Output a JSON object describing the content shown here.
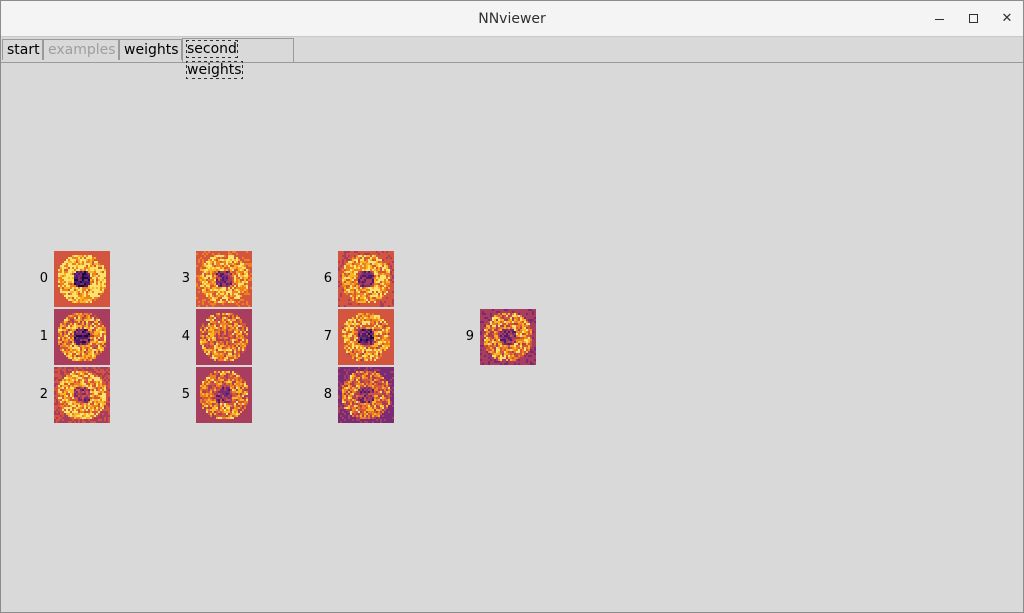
{
  "window": {
    "title": "NNviewer"
  },
  "tabs": [
    {
      "label": "start",
      "state": "normal"
    },
    {
      "label": "examples",
      "state": "disabled"
    },
    {
      "label": "weights",
      "state": "normal"
    },
    {
      "label": "second weights",
      "state": "active"
    }
  ],
  "weights": {
    "colormap": [
      "#1a0b3c",
      "#4c1d6b",
      "#7a2b76",
      "#a83d5e",
      "#d4553f",
      "#f07f20",
      "#f9b51f",
      "#fbe36c"
    ],
    "items": [
      {
        "label": "0",
        "base": 4.3,
        "ring": 6.3,
        "center": 1.0
      },
      {
        "label": "1",
        "base": 3.0,
        "ring": 5.2,
        "center": 1.4
      },
      {
        "label": "2",
        "base": 3.5,
        "ring": 5.6,
        "center": 2.8
      },
      {
        "label": "3",
        "base": 4.4,
        "ring": 5.8,
        "center": 2.3
      },
      {
        "label": "4",
        "base": 3.2,
        "ring": 5.0,
        "center": 4.0
      },
      {
        "label": "5",
        "base": 3.0,
        "ring": 4.8,
        "center": 2.6
      },
      {
        "label": "6",
        "base": 3.6,
        "ring": 5.6,
        "center": 2.0
      },
      {
        "label": "7",
        "base": 4.2,
        "ring": 5.4,
        "center": 1.6
      },
      {
        "label": "8",
        "base": 2.4,
        "ring": 4.6,
        "center": 2.4
      },
      {
        "label": "9",
        "base": 2.6,
        "ring": 5.0,
        "center": 2.2
      }
    ]
  }
}
